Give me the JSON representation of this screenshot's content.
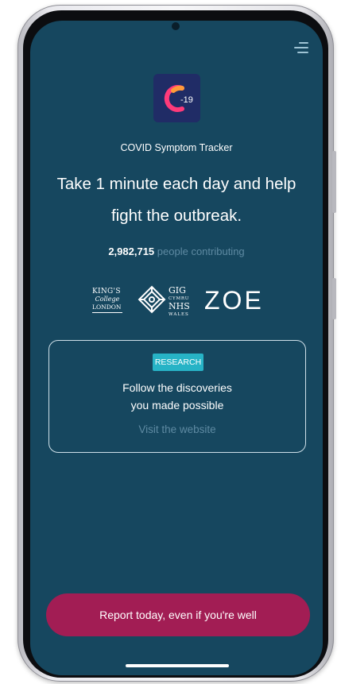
{
  "app": {
    "name": "COVID Symptom Tracker",
    "icon_text": "-19"
  },
  "headline": {
    "line1": "Take 1 minute each day and help",
    "line2": "fight the outbreak."
  },
  "contributors": {
    "count": "2,982,715",
    "label": "people contributing"
  },
  "partners": {
    "kcl": {
      "line1": "KING'S",
      "line2": "College",
      "line3": "LONDON"
    },
    "nhs": {
      "line1": "GIG",
      "line2": "CYMRU",
      "line3": "NHS",
      "line4": "WALES"
    },
    "zoe": "ZOE"
  },
  "research_card": {
    "badge": "RESEARCH",
    "line1": "Follow the discoveries",
    "line2": "you made possible",
    "link": "Visit the website"
  },
  "report_button": {
    "label": "Report today, even if you're well"
  },
  "colors": {
    "background": "#16475f",
    "accent_button": "#a21d54",
    "badge": "#27b3c6",
    "muted_text": "#5e8aa2"
  },
  "icons": [
    "menu-icon",
    "app-logo-icon",
    "nhs-wales-icon"
  ]
}
